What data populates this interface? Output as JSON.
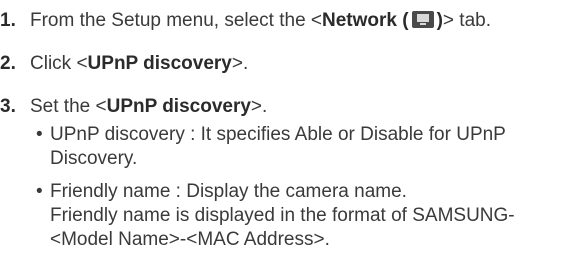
{
  "steps": [
    {
      "number": "1.",
      "before": "From the Setup menu, select the <",
      "bold": "Network (",
      "bold_after": ")",
      "after": "> tab.",
      "icon": "network-monitor-icon"
    },
    {
      "number": "2.",
      "before": "Click <",
      "bold": "UPnP discovery",
      "after": ">."
    },
    {
      "number": "3.",
      "before": "Set the <",
      "bold": "UPnP discovery",
      "after": ">."
    }
  ],
  "bullets": [
    {
      "bullet": "•",
      "lines": [
        "UPnP discovery : It specifies Able or Disable for UPnP",
        "Discovery."
      ]
    },
    {
      "bullet": "•",
      "lines": [
        "Friendly name : Display the camera name.",
        "Friendly name is displayed in the format of SAMSUNG-",
        "<Model Name>-<MAC Address>."
      ]
    }
  ]
}
